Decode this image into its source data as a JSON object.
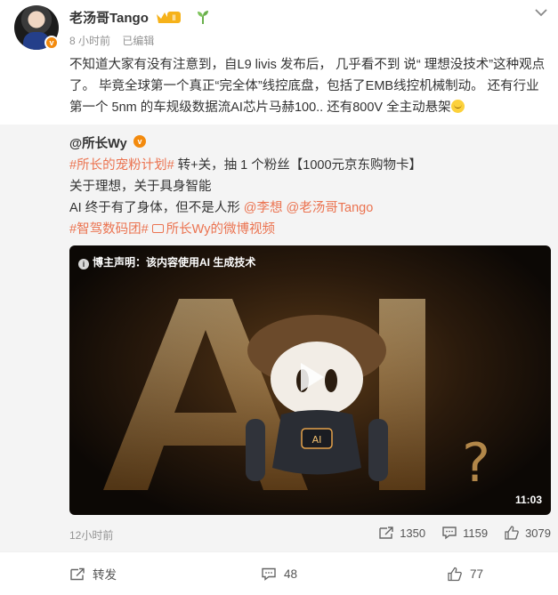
{
  "post": {
    "author": "老汤哥Tango",
    "time": "8 小时前",
    "edited": "已编辑",
    "text": "不知道大家有没有注意到，自L9 livis 发布后， 几乎看不到 说“ 理想没技术”这种观点了。 毕竟全球第一个真正“完全体”线控底盘，包括了EMB线控机械制动。 还有行业第一个 5nm 的车规级数据流AI芯片马赫100.. 还有800V 全主动悬架",
    "icons": [
      "crown-icon",
      "sprout-icon",
      "chevron-down-icon",
      "emoji-icon"
    ]
  },
  "repost": {
    "author": "@所长Wy",
    "tag1": "#所长的宠粉计划#",
    "line1_rest": " 转+关，抽 1 个粉丝【1000元京东购物卡】",
    "line2": "关于理想，关于具身智能",
    "line3_text": "AI 终于有了身体，但不是人形",
    "mention1": "@李想",
    "mention2": "@老汤哥Tango",
    "tag2": "#智驾数码团#",
    "video_link": "所长Wy的微博视频",
    "video": {
      "notice": "博主声明：该内容使用AI 生成技术",
      "duration": "11:03",
      "overlay_text": "AI"
    },
    "time": "12小时前",
    "reposts": "1350",
    "comments": "1159",
    "likes": "3079"
  },
  "footer": {
    "repost_label": "转发",
    "comments": "48",
    "likes": "77"
  },
  "colors": {
    "accent": "#eb7350",
    "badge": "#f38a0d",
    "muted": "#939393",
    "repost_bg": "#f4f4f4"
  }
}
